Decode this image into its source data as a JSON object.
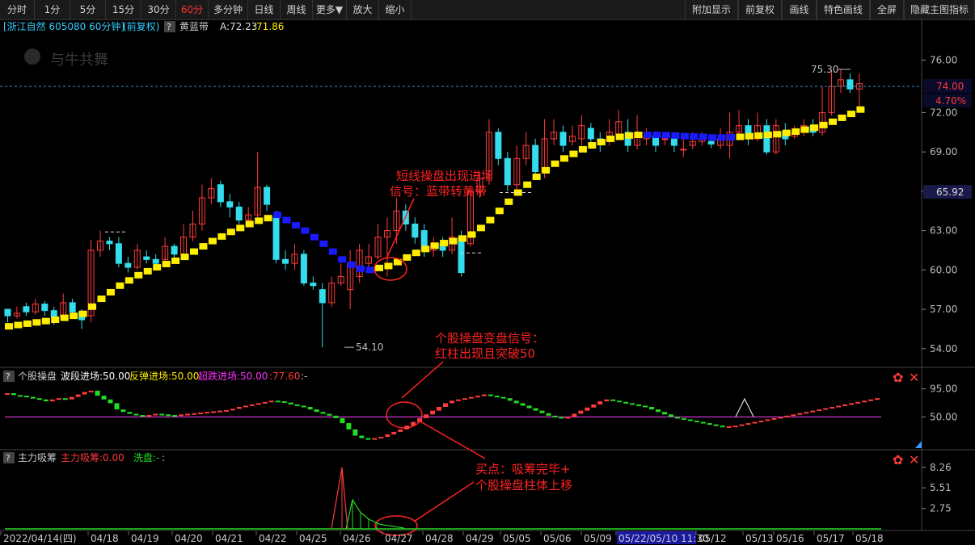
{
  "toolbar_left": [
    "分时",
    "1分",
    "5分",
    "15分",
    "30分",
    "60分",
    "多分钟",
    "日线",
    "周线",
    "更多▼",
    "放大",
    "缩小"
  ],
  "toolbar_active": "60分",
  "toolbar_right": [
    "附加显示",
    "前复权",
    "画线",
    "特色画线",
    "全屏",
    "隐藏主图指标"
  ],
  "main_header": {
    "stock": "[浙江自然 605080 60分钟]",
    "mode": "(前复权)",
    "help": "?",
    "indicator": "黄蓝带",
    "a_label": "A:72.23",
    "value": ":71.86"
  },
  "watermark": "与牛共舞",
  "price_axis": [
    "76.00",
    "72.00",
    "69.00",
    "66.00",
    "63.00",
    "60.00",
    "57.00",
    "54.00"
  ],
  "price_tags": {
    "current": "74.00",
    "pct": "4.70%",
    "mark": "65.92"
  },
  "high_label": "75.30",
  "low_label": "54.10",
  "annotations": {
    "a1_line1": "短线操盘出现进场",
    "a1_line2": "信号：蓝带转黄带",
    "a2_line1": "个股操盘变盘信号：",
    "a2_line2": "红柱出现且突破50",
    "a3_line1": "买点：吸筹完毕+",
    "a3_line2": "个股操盘柱体上移"
  },
  "panel2_header": {
    "help": "?",
    "name": "个股操盘",
    "wave": "波段进场:50.00",
    "rebound": "反弹进场:50.00",
    "oversold": "超跌进场:50.00",
    "val": ":77.60",
    "tail": ":-"
  },
  "panel2_axis": [
    "95.00",
    "50.00"
  ],
  "panel3_header": {
    "help": "?",
    "name": "主力吸筹",
    "absorb": "主力吸筹:0.00",
    "wash": "洗盘:-",
    "tail": ":"
  },
  "panel3_axis": [
    "8.26",
    "5.51",
    "2.75"
  ],
  "dates": [
    "2022/04/14(四)",
    "04/18",
    "04/19",
    "04/20",
    "04/21",
    "04/22",
    "04/25",
    "04/26",
    "04/27",
    "04/28",
    "04/29",
    "05/05",
    "05/06",
    "05/09",
    "05/22/05/10 11:30",
    "05/12",
    "05/13",
    "05/16",
    "05/17",
    "05/18"
  ],
  "date_highlight": "05/22/05/10 11:30",
  "colors": {
    "up": "#ff3b3b",
    "down": "#33ddee",
    "yellow": "#ffee00",
    "blue": "#1a1aff",
    "magenta": "#cc33cc",
    "green": "#22dd22"
  },
  "chart_data": {
    "type": "candlestick",
    "ylim": [
      53,
      78
    ],
    "bars": [
      [
        57.0,
        56.5,
        57.0,
        56.0
      ],
      [
        56.5,
        56.7,
        57.2,
        56.3
      ],
      [
        57.2,
        56.8,
        57.5,
        56.5
      ],
      [
        56.8,
        57.4,
        57.8,
        56.6
      ],
      [
        57.4,
        56.9,
        57.6,
        56.5
      ],
      [
        56.9,
        56.4,
        57.2,
        55.8
      ],
      [
        56.4,
        57.5,
        58.2,
        56.2
      ],
      [
        57.5,
        56.8,
        57.8,
        56.5
      ],
      [
        56.8,
        56.2,
        57.0,
        55.5
      ],
      [
        56.5,
        61.5,
        62.3,
        56.0
      ],
      [
        61.5,
        62.2,
        63.0,
        61.0
      ],
      [
        62.2,
        62.0,
        62.5,
        61.5
      ],
      [
        62.0,
        60.5,
        62.5,
        60.2
      ],
      [
        60.5,
        60.2,
        61.0,
        59.8
      ],
      [
        60.2,
        61.5,
        62.0,
        60.0
      ],
      [
        61.0,
        60.8,
        61.5,
        60.5
      ],
      [
        60.8,
        60.5,
        61.2,
        60.2
      ],
      [
        60.8,
        61.8,
        62.5,
        60.5
      ],
      [
        61.8,
        61.2,
        62.0,
        60.8
      ],
      [
        61.2,
        62.5,
        63.5,
        61.0
      ],
      [
        62.5,
        63.5,
        64.5,
        62.2
      ],
      [
        63.5,
        65.5,
        66.5,
        63.0
      ],
      [
        65.5,
        66.2,
        67.0,
        65.0
      ],
      [
        66.5,
        65.2,
        66.8,
        64.8
      ],
      [
        65.2,
        64.8,
        65.8,
        64.0
      ],
      [
        64.8,
        63.8,
        65.2,
        63.5
      ],
      [
        63.8,
        64.2,
        64.8,
        63.5
      ],
      [
        64.2,
        66.3,
        69.0,
        64.0
      ],
      [
        66.3,
        65.0,
        66.5,
        64.5
      ],
      [
        64.0,
        60.8,
        64.5,
        60.5
      ],
      [
        60.8,
        60.5,
        61.5,
        60.0
      ],
      [
        60.5,
        61.2,
        62.0,
        60.0
      ],
      [
        61.2,
        59.0,
        61.5,
        58.8
      ],
      [
        59.0,
        58.8,
        59.5,
        58.5
      ],
      [
        58.5,
        57.5,
        59.0,
        54.1
      ],
      [
        57.5,
        59.0,
        59.5,
        57.2
      ],
      [
        59.0,
        59.5,
        60.5,
        58.8
      ],
      [
        58.5,
        60.5,
        61.5,
        57.0
      ],
      [
        59.5,
        61.5,
        62.0,
        59.0
      ],
      [
        60.5,
        61.0,
        62.0,
        60.0
      ],
      [
        61.0,
        62.5,
        63.5,
        60.8
      ],
      [
        62.5,
        63.0,
        64.0,
        59.5
      ],
      [
        63.0,
        64.5,
        65.5,
        62.0
      ],
      [
        64.5,
        63.5,
        65.0,
        63.0
      ],
      [
        63.5,
        62.5,
        64.0,
        62.0
      ],
      [
        63.0,
        61.5,
        63.5,
        61.0
      ],
      [
        61.5,
        62.0,
        62.5,
        61.0
      ],
      [
        62.0,
        61.5,
        62.5,
        61.0
      ],
      [
        61.5,
        62.5,
        64.0,
        61.2
      ],
      [
        62.5,
        59.8,
        63.0,
        59.5
      ],
      [
        62.0,
        66.0,
        66.0,
        61.8
      ],
      [
        66.0,
        67.0,
        67.5,
        65.5
      ],
      [
        67.0,
        70.5,
        71.5,
        66.5
      ],
      [
        70.5,
        68.5,
        70.8,
        68.0
      ],
      [
        68.5,
        66.5,
        69.0,
        66.0
      ],
      [
        66.5,
        68.5,
        69.5,
        66.0
      ],
      [
        68.5,
        69.5,
        70.5,
        68.0
      ],
      [
        69.5,
        67.5,
        70.0,
        67.0
      ],
      [
        67.5,
        70.0,
        71.5,
        67.0
      ],
      [
        70.0,
        70.5,
        71.5,
        69.5
      ],
      [
        70.5,
        69.5,
        71.0,
        69.0
      ],
      [
        69.8,
        70.2,
        71.0,
        69.5
      ],
      [
        70.0,
        71.0,
        71.8,
        69.5
      ],
      [
        70.8,
        70.0,
        71.2,
        69.5
      ],
      [
        70.0,
        69.8,
        70.5,
        69.0
      ],
      [
        69.8,
        70.5,
        71.5,
        69.5
      ],
      [
        70.3,
        71.3,
        72.2,
        70.0
      ],
      [
        70.5,
        69.5,
        71.5,
        69.0
      ],
      [
        69.5,
        70.5,
        71.8,
        69.2
      ],
      [
        70.0,
        70.2,
        70.8,
        69.5
      ],
      [
        70.2,
        69.5,
        70.5,
        69.0
      ],
      [
        70.0,
        70.0,
        70.5,
        69.5
      ],
      [
        70.0,
        69.5,
        70.5,
        69.0
      ],
      [
        69.2,
        69.2,
        70.0,
        68.6
      ],
      [
        69.5,
        69.8,
        70.5,
        69.2
      ],
      [
        69.8,
        70.0,
        70.5,
        69.5
      ],
      [
        69.8,
        69.6,
        70.2,
        69.3
      ],
      [
        69.5,
        70.0,
        70.8,
        69.2
      ],
      [
        69.5,
        70.5,
        72.0,
        68.5
      ],
      [
        70.5,
        71.0,
        72.2,
        70.0
      ],
      [
        71.0,
        70.0,
        71.5,
        69.5
      ],
      [
        70.0,
        71.0,
        72.0,
        69.8
      ],
      [
        71.0,
        69.0,
        71.5,
        68.8
      ],
      [
        69.0,
        71.0,
        71.5,
        68.8
      ],
      [
        70.5,
        70.0,
        71.2,
        69.5
      ],
      [
        70.2,
        70.5,
        71.0,
        70.0
      ],
      [
        70.5,
        71.0,
        71.5,
        70.2
      ],
      [
        71.0,
        70.5,
        71.5,
        70.2
      ],
      [
        70.5,
        72.0,
        74.0,
        70.2
      ],
      [
        72.0,
        74.0,
        75.3,
        71.8
      ],
      [
        74.0,
        74.5,
        75.3,
        73.5
      ],
      [
        74.5,
        73.8,
        75.0,
        73.5
      ],
      [
        73.8,
        74.2,
        75.0,
        72.0
      ]
    ],
    "band": [
      55.7,
      55.8,
      55.9,
      56.0,
      56.1,
      56.2,
      56.35,
      56.5,
      56.65,
      57.2,
      57.8,
      58.3,
      58.8,
      59.2,
      59.6,
      59.9,
      60.2,
      60.45,
      60.7,
      61.0,
      61.4,
      61.8,
      62.2,
      62.55,
      62.9,
      63.2,
      63.5,
      63.75,
      63.95,
      64.2,
      63.8,
      63.4,
      63.0,
      62.5,
      62.0,
      61.4,
      60.8,
      60.4,
      60.1,
      60.0,
      60.15,
      60.3,
      60.6,
      60.95,
      61.3,
      61.6,
      61.85,
      62.05,
      62.2,
      62.4,
      62.7,
      63.2,
      63.8,
      64.5,
      65.2,
      65.9,
      66.5,
      67.1,
      67.6,
      68.1,
      68.5,
      68.85,
      69.2,
      69.5,
      69.75,
      70.0,
      70.15,
      70.25,
      70.3,
      70.3,
      70.3,
      70.28,
      70.25,
      70.2,
      70.18,
      70.15,
      70.1,
      70.1,
      70.12,
      70.15,
      70.2,
      70.25,
      70.3,
      70.35,
      70.45,
      70.55,
      70.7,
      70.85,
      71.05,
      71.3,
      71.6,
      71.9,
      72.23
    ],
    "band_blue_ranges": [
      [
        29,
        39
      ],
      [
        69,
        78
      ]
    ],
    "osc_values": [
      88,
      85,
      84,
      82,
      80,
      78,
      75,
      78,
      80,
      78,
      82,
      86,
      90,
      92,
      84,
      78,
      72,
      62,
      58,
      55,
      53,
      52,
      53,
      55,
      54,
      53,
      52,
      54,
      55,
      56,
      57,
      58,
      59,
      60,
      61,
      63,
      66,
      68,
      70,
      72,
      74,
      76,
      75,
      73,
      70,
      68,
      66,
      62,
      58,
      55,
      52,
      48,
      40,
      30,
      20,
      16,
      14,
      16,
      18,
      22,
      26,
      30,
      36,
      42,
      48,
      54,
      60,
      66,
      72,
      76,
      78,
      80,
      82,
      84,
      86,
      84,
      82,
      80,
      76,
      72,
      68,
      64,
      60,
      56,
      52,
      50,
      48,
      50,
      55,
      60,
      65,
      70,
      75,
      78,
      76,
      74,
      72,
      70,
      68,
      66,
      62,
      58,
      54,
      50,
      48,
      46,
      44,
      42,
      40,
      38,
      36,
      35,
      35,
      36,
      38,
      40,
      42,
      44,
      46,
      48,
      50,
      52,
      54,
      56,
      58,
      60,
      62,
      64,
      66,
      68,
      70,
      72,
      74,
      76,
      78,
      80
    ],
    "absorb_peaks": [
      {
        "index": 34,
        "value": 8.26,
        "color": "red"
      },
      {
        "index": 36,
        "value": 3.9,
        "color": "green"
      }
    ]
  }
}
